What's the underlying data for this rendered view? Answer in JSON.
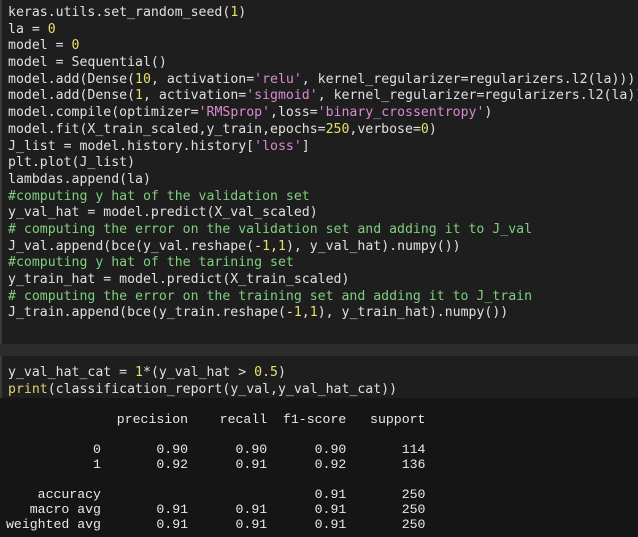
{
  "cell1": {
    "lines": [
      [
        {
          "t": "keras.utils.",
          "c": "pl"
        },
        {
          "t": "set_random_seed",
          "c": "pl"
        },
        {
          "t": "(",
          "c": "pl"
        },
        {
          "t": "1",
          "c": "num"
        },
        {
          "t": ")",
          "c": "pl"
        }
      ],
      [
        {
          "t": "la = ",
          "c": "pl"
        },
        {
          "t": "0",
          "c": "num"
        }
      ],
      [
        {
          "t": "model = ",
          "c": "pl"
        },
        {
          "t": "0",
          "c": "num"
        }
      ],
      [
        {
          "t": "model = Sequential()",
          "c": "pl"
        }
      ],
      [
        {
          "t": "model.add(Dense(",
          "c": "pl"
        },
        {
          "t": "10",
          "c": "num"
        },
        {
          "t": ", activation=",
          "c": "pl"
        },
        {
          "t": "'relu'",
          "c": "str"
        },
        {
          "t": ", kernel_regularizer=regularizers.l2(la)))",
          "c": "pl"
        }
      ],
      [
        {
          "t": "model.add(Dense(",
          "c": "pl"
        },
        {
          "t": "1",
          "c": "num"
        },
        {
          "t": ", activation=",
          "c": "pl"
        },
        {
          "t": "'sigmoid'",
          "c": "str"
        },
        {
          "t": ", kernel_regularizer=regularizers.l2(la)))",
          "c": "pl"
        }
      ],
      [
        {
          "t": "model.compile(optimizer=",
          "c": "pl"
        },
        {
          "t": "'RMSprop'",
          "c": "str"
        },
        {
          "t": ",loss=",
          "c": "pl"
        },
        {
          "t": "'binary_crossentropy'",
          "c": "str"
        },
        {
          "t": ")",
          "c": "pl"
        }
      ],
      [
        {
          "t": "model.fit(X_train_scaled,y_train,epochs=",
          "c": "pl"
        },
        {
          "t": "250",
          "c": "num"
        },
        {
          "t": ",verbose=",
          "c": "pl"
        },
        {
          "t": "0",
          "c": "num"
        },
        {
          "t": ")",
          "c": "pl"
        }
      ],
      [
        {
          "t": "J_list = model.history.history[",
          "c": "pl"
        },
        {
          "t": "'loss'",
          "c": "str"
        },
        {
          "t": "]",
          "c": "pl"
        }
      ],
      [
        {
          "t": "plt.plot(J_list)",
          "c": "pl"
        }
      ],
      [
        {
          "t": "lambdas.append(la)",
          "c": "pl"
        }
      ],
      [
        {
          "t": "#computing y hat of the validation set",
          "c": "com"
        }
      ],
      [
        {
          "t": "y_val_hat = model.predict(X_val_scaled)",
          "c": "pl"
        }
      ],
      [
        {
          "t": "# computing the error on the validation set and adding it to J_val",
          "c": "com"
        }
      ],
      [
        {
          "t": "J_val.append(bce(y_val.reshape(-",
          "c": "pl"
        },
        {
          "t": "1",
          "c": "num"
        },
        {
          "t": ",",
          "c": "pl"
        },
        {
          "t": "1",
          "c": "num"
        },
        {
          "t": "), y_val_hat).numpy())",
          "c": "pl"
        }
      ],
      [
        {
          "t": "#computing y hat of the tarining set",
          "c": "com"
        }
      ],
      [
        {
          "t": "y_train_hat = model.predict(X_train_scaled)",
          "c": "pl"
        }
      ],
      [
        {
          "t": "# computing the error on the training set and adding it to J_train",
          "c": "com"
        }
      ],
      [
        {
          "t": "J_train.append(bce(y_train.reshape(-",
          "c": "pl"
        },
        {
          "t": "1",
          "c": "num"
        },
        {
          "t": ",",
          "c": "pl"
        },
        {
          "t": "1",
          "c": "num"
        },
        {
          "t": "), y_train_hat).numpy())",
          "c": "pl"
        }
      ]
    ]
  },
  "cell2": {
    "lines": [
      [
        {
          "t": "y_val_hat_cat = ",
          "c": "pl"
        },
        {
          "t": "1",
          "c": "num"
        },
        {
          "t": "*(y_val_hat > ",
          "c": "pl"
        },
        {
          "t": "0.5",
          "c": "num"
        },
        {
          "t": ")",
          "c": "pl"
        }
      ],
      [
        {
          "t": "print",
          "c": "fn"
        },
        {
          "t": "(classification_report(y_val,y_val_hat_cat))",
          "c": "pl"
        }
      ]
    ]
  },
  "output": {
    "text": "              precision    recall  f1-score   support\n\n           0       0.90      0.90      0.90       114\n           1       0.92      0.91      0.92       136\n\n    accuracy                           0.91       250\n   macro avg       0.91      0.91      0.91       250\nweighted avg       0.91      0.91      0.91       250"
  },
  "colors": {
    "plain": "#e0e0e0",
    "string": "#d98bd2",
    "number": "#e6e06a",
    "comment": "#7fcf7f",
    "function": "#e6d074",
    "background": "#1e1e1e"
  }
}
